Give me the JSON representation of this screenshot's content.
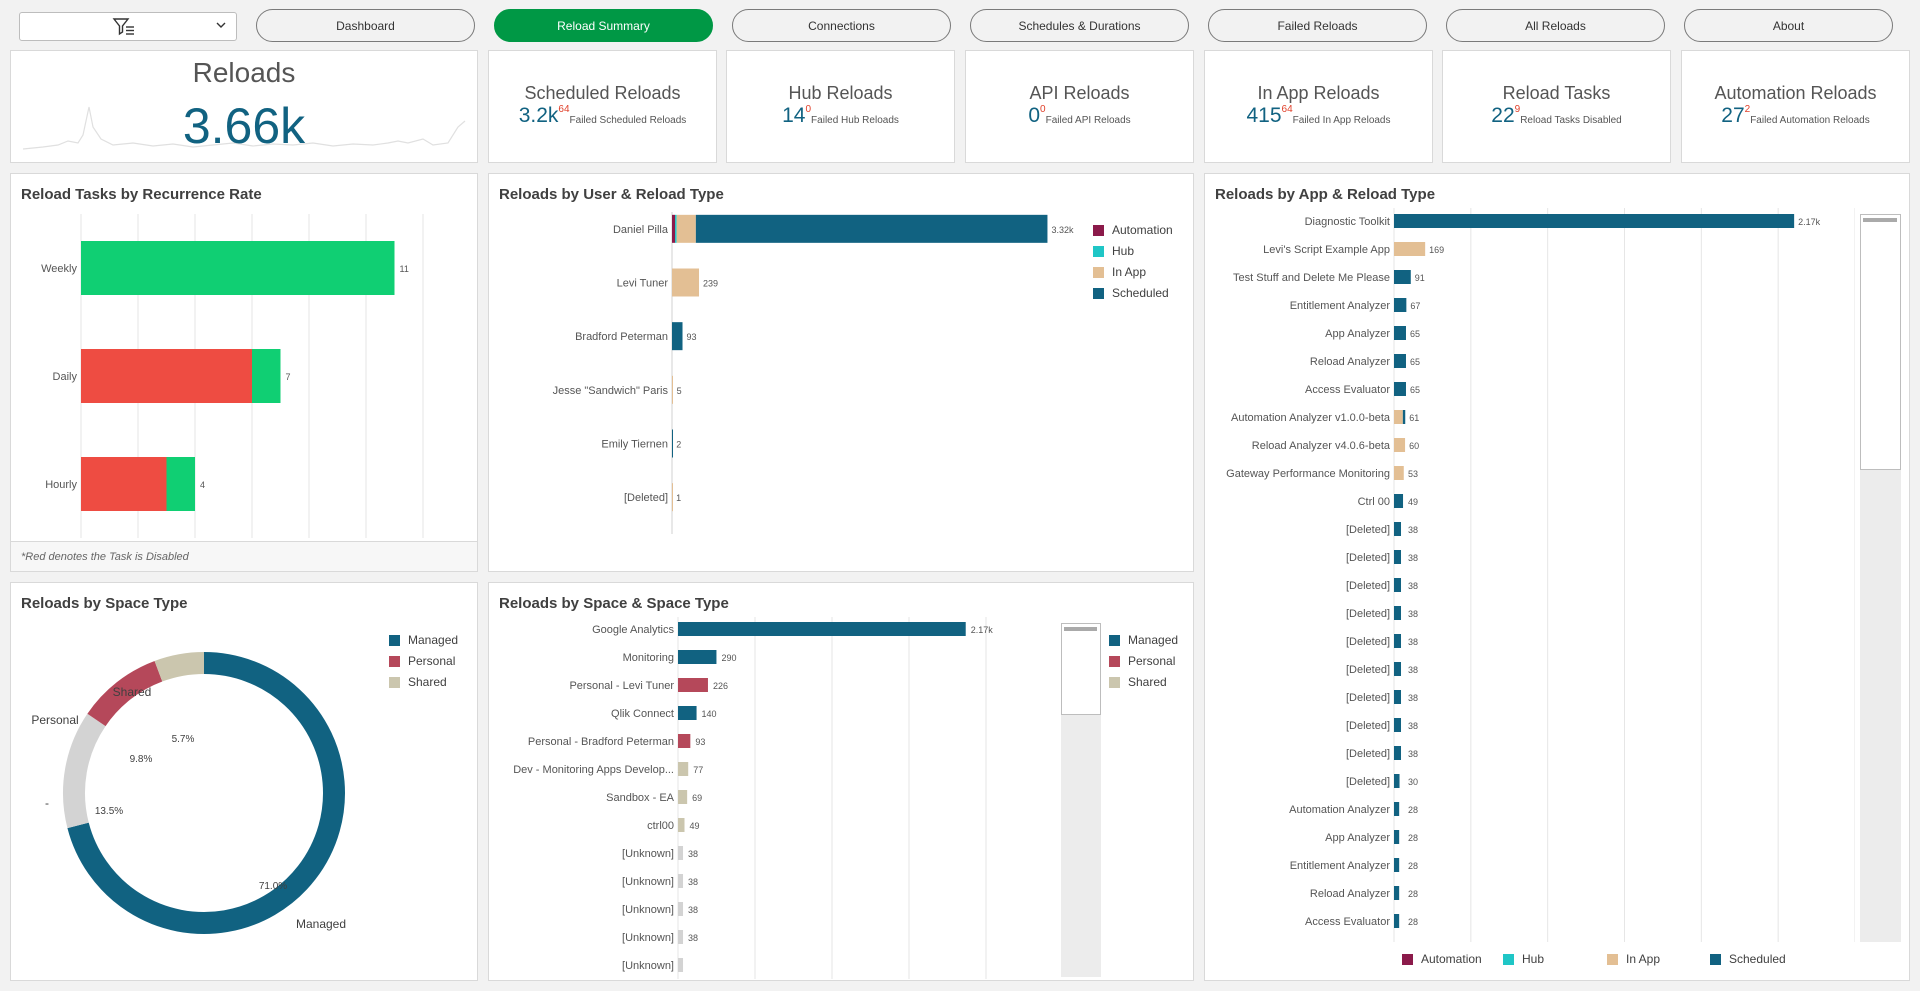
{
  "nav": {
    "buttons": [
      {
        "label": "Dashboard",
        "active": false
      },
      {
        "label": "Reload Summary",
        "active": true
      },
      {
        "label": "Connections",
        "active": false
      },
      {
        "label": "Schedules & Durations",
        "active": false
      },
      {
        "label": "Failed Reloads",
        "active": false
      },
      {
        "label": "All Reloads",
        "active": false
      },
      {
        "label": "About",
        "active": false
      }
    ]
  },
  "kpis": {
    "main": {
      "title": "Reloads",
      "value": "3.66k"
    },
    "cards": [
      {
        "title": "Scheduled Reloads",
        "value": "3.2k",
        "failed": "64",
        "sub": "Failed Scheduled Reloads"
      },
      {
        "title": "Hub Reloads",
        "value": "14",
        "failed": "0",
        "sub": "Failed Hub Reloads"
      },
      {
        "title": "API Reloads",
        "value": "0",
        "failed": "0",
        "sub": "Failed API Reloads"
      },
      {
        "title": "In App Reloads",
        "value": "415",
        "failed": "64",
        "sub": "Failed In App Reloads"
      },
      {
        "title": "Reload Tasks",
        "value": "22",
        "failed": "9",
        "sub": "Reload Tasks Disabled"
      },
      {
        "title": "Automation Reloads",
        "value": "27",
        "failed": "2",
        "sub": "Failed Automation Reloads"
      }
    ]
  },
  "colors": {
    "automation": "#8b1a4a",
    "hub": "#1fc6c6",
    "inapp": "#e3bf94",
    "scheduled": "#116281",
    "enabled": "#10cf73",
    "disabled": "#ee4c42",
    "managed": "#116281",
    "personal": "#b5485a",
    "shared": "#cbc6ae",
    "unknown": "#d3d3d3"
  },
  "recurrence": {
    "title": "Reload Tasks by Recurrence Rate",
    "footnote": "*Red denotes the Task is Disabled",
    "chart_data": {
      "type": "bar",
      "orientation": "horizontal",
      "stacked": true,
      "categories": [
        "Weekly",
        "Daily",
        "Hourly"
      ],
      "series": [
        {
          "key": "disabled",
          "values": [
            0,
            6,
            3
          ]
        },
        {
          "key": "enabled",
          "values": [
            11,
            1,
            1
          ]
        }
      ],
      "totals": [
        "11",
        "7",
        "4"
      ],
      "xlim": [
        0,
        12
      ]
    }
  },
  "userType": {
    "title": "Reloads by User & Reload Type",
    "legend": [
      "Automation",
      "Hub",
      "In App",
      "Scheduled"
    ],
    "chart_data": {
      "type": "bar",
      "orientation": "horizontal",
      "stacked": true,
      "categories": [
        "Daniel Pilla",
        "Levi Tuner",
        "Bradford Peterman",
        "Jesse \"Sandwich\" Paris",
        "Emily Tiernen",
        "[Deleted]"
      ],
      "series": [
        {
          "name": "Automation",
          "values": [
            27,
            0,
            0,
            0,
            0,
            0
          ]
        },
        {
          "name": "Hub",
          "values": [
            14,
            0,
            0,
            0,
            0,
            0
          ]
        },
        {
          "name": "In App",
          "values": [
            170,
            239,
            0,
            5,
            0,
            1
          ]
        },
        {
          "name": "Scheduled",
          "values": [
            3110,
            0,
            93,
            0,
            2,
            0
          ]
        }
      ],
      "totals": [
        "3.32k",
        "239",
        "93",
        "5",
        "2",
        "1"
      ],
      "xlim": [
        0,
        3600
      ]
    }
  },
  "appType": {
    "title": "Reloads by App & Reload Type",
    "legend": [
      "Automation",
      "Hub",
      "In App",
      "Scheduled"
    ],
    "chart_data": {
      "type": "bar",
      "orientation": "horizontal",
      "stacked": true,
      "categories": [
        "Diagnostic Toolkit",
        "Levi's Script Example App",
        "Test Stuff and Delete Me Please",
        "Entitlement Analyzer",
        "App Analyzer",
        "Reload Analyzer",
        "Access Evaluator",
        "Automation Analyzer v1.0.0-beta",
        "Reload Analyzer v4.0.6-beta",
        "Gateway Performance Monitoring",
        "Ctrl 00",
        "[Deleted]",
        "[Deleted]",
        "[Deleted]",
        "[Deleted]",
        "[Deleted]",
        "[Deleted]",
        "[Deleted]",
        "[Deleted]",
        "[Deleted]",
        "[Deleted]",
        "Automation Analyzer",
        "App Analyzer",
        "Entitlement Analyzer",
        "Reload Analyzer",
        "Access Evaluator"
      ],
      "series": [
        {
          "name": "Automation",
          "values": [
            0,
            0,
            0,
            0,
            0,
            0,
            0,
            0,
            0,
            0,
            0,
            0,
            0,
            0,
            0,
            0,
            0,
            0,
            0,
            0,
            0,
            0,
            0,
            0,
            0,
            0
          ]
        },
        {
          "name": "Hub",
          "values": [
            0,
            0,
            0,
            0,
            0,
            0,
            0,
            0,
            0,
            0,
            0,
            0,
            0,
            0,
            0,
            0,
            0,
            0,
            0,
            0,
            0,
            0,
            0,
            0,
            0,
            0
          ]
        },
        {
          "name": "In App",
          "values": [
            0,
            169,
            0,
            0,
            0,
            0,
            0,
            48,
            60,
            53,
            0,
            0,
            0,
            0,
            0,
            0,
            0,
            0,
            0,
            0,
            0,
            0,
            0,
            0,
            0,
            0
          ]
        },
        {
          "name": "Scheduled",
          "values": [
            2170,
            0,
            91,
            67,
            65,
            65,
            65,
            13,
            0,
            0,
            49,
            38,
            38,
            38,
            38,
            38,
            38,
            38,
            38,
            38,
            30,
            28,
            28,
            28,
            28,
            28
          ]
        }
      ],
      "totals": [
        "2.17k",
        "169",
        "91",
        "67",
        "65",
        "65",
        "65",
        "61",
        "60",
        "53",
        "49",
        "38",
        "38",
        "38",
        "38",
        "38",
        "38",
        "38",
        "38",
        "38",
        "30",
        "28",
        "28",
        "28",
        "28",
        "28"
      ],
      "xlim": [
        0,
        2500
      ]
    }
  },
  "spaceType": {
    "title": "Reloads by Space Type",
    "legend": [
      "Managed",
      "Personal",
      "Shared"
    ],
    "chart_data": {
      "type": "pie",
      "donut": true,
      "slices": [
        {
          "label": "Managed",
          "key": "managed",
          "pct": "71.0%",
          "value": 71.0
        },
        {
          "label": "-",
          "key": "unknown",
          "pct": "13.5%",
          "value": 13.5
        },
        {
          "label": "Personal",
          "key": "personal",
          "pct": "9.8%",
          "value": 9.8
        },
        {
          "label": "Shared",
          "key": "shared",
          "pct": "5.7%",
          "value": 5.7
        }
      ]
    }
  },
  "spaceSpace": {
    "title": "Reloads by Space & Space Type",
    "legend": [
      "Managed",
      "Personal",
      "Shared"
    ],
    "chart_data": {
      "type": "bar",
      "orientation": "horizontal",
      "categories": [
        "Google Analytics",
        "Monitoring",
        "Personal - Levi Tuner",
        "Qlik Connect",
        "Personal - Bradford Peterman",
        "Dev - Monitoring Apps Develop...",
        "Sandbox - EA",
        "ctrl00",
        "[Unknown]",
        "[Unknown]",
        "[Unknown]",
        "[Unknown]",
        "[Unknown]"
      ],
      "values": [
        2170,
        290,
        226,
        140,
        93,
        77,
        69,
        49,
        38,
        38,
        38,
        38,
        38
      ],
      "types": [
        "managed",
        "managed",
        "personal",
        "managed",
        "personal",
        "shared",
        "shared",
        "shared",
        "unknown",
        "unknown",
        "unknown",
        "unknown",
        "unknown"
      ],
      "labels": [
        "2.17k",
        "290",
        "226",
        "140",
        "93",
        "77",
        "69",
        "49",
        "38",
        "38",
        "38",
        "38",
        ""
      ],
      "xlim": [
        0,
        2500
      ]
    }
  }
}
